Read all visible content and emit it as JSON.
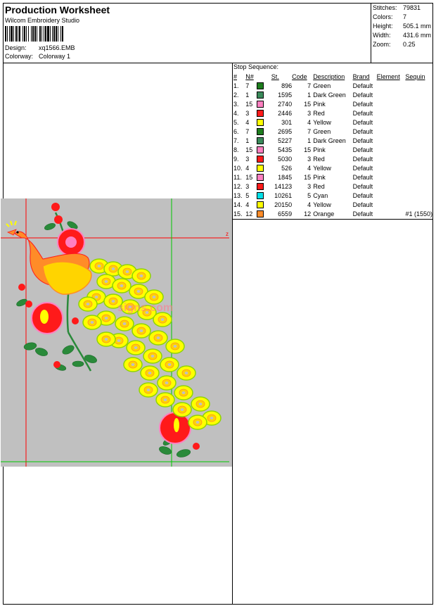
{
  "header": {
    "title": "Production Worksheet",
    "software": "Wilcom Embroidery Studio",
    "design_label": "Design:",
    "design_value": "xq1566.EMB",
    "colorway_label": "Colorway:",
    "colorway_value": "Colorway 1"
  },
  "stats": [
    {
      "label": "Stitches:",
      "value": "79831"
    },
    {
      "label": "Colors:",
      "value": "7"
    },
    {
      "label": "Height:",
      "value": "505.1 mm"
    },
    {
      "label": "Width:",
      "value": "431.6 mm"
    },
    {
      "label": "Zoom:",
      "value": "0.25"
    }
  ],
  "stop_sequence": {
    "title": "Stop Sequence:",
    "columns": [
      "#",
      "N#",
      "St.",
      "Code",
      "Description",
      "Brand",
      "Element",
      "Sequin"
    ],
    "rows": [
      {
        "num": "1.",
        "n": "7",
        "color": "#1e7d1e",
        "st": "896",
        "code": "7",
        "desc": "Green",
        "brand": "Default",
        "element": "",
        "sequin": ""
      },
      {
        "num": "2.",
        "n": "1",
        "color": "#3a8a5a",
        "st": "1595",
        "code": "1",
        "desc": "Dark Green",
        "brand": "Default",
        "element": "",
        "sequin": ""
      },
      {
        "num": "3.",
        "n": "15",
        "color": "#ff7fc0",
        "st": "2740",
        "code": "15",
        "desc": "Pink",
        "brand": "Default",
        "element": "",
        "sequin": ""
      },
      {
        "num": "4.",
        "n": "3",
        "color": "#ff1a1a",
        "st": "2446",
        "code": "3",
        "desc": "Red",
        "brand": "Default",
        "element": "",
        "sequin": ""
      },
      {
        "num": "5.",
        "n": "4",
        "color": "#ffff00",
        "st": "301",
        "code": "4",
        "desc": "Yellow",
        "brand": "Default",
        "element": "",
        "sequin": ""
      },
      {
        "num": "6.",
        "n": "7",
        "color": "#1e7d1e",
        "st": "2695",
        "code": "7",
        "desc": "Green",
        "brand": "Default",
        "element": "",
        "sequin": ""
      },
      {
        "num": "7.",
        "n": "1",
        "color": "#3a8a5a",
        "st": "5227",
        "code": "1",
        "desc": "Dark Green",
        "brand": "Default",
        "element": "",
        "sequin": ""
      },
      {
        "num": "8.",
        "n": "15",
        "color": "#ff7fc0",
        "st": "5435",
        "code": "15",
        "desc": "Pink",
        "brand": "Default",
        "element": "",
        "sequin": ""
      },
      {
        "num": "9.",
        "n": "3",
        "color": "#ff1a1a",
        "st": "5030",
        "code": "3",
        "desc": "Red",
        "brand": "Default",
        "element": "",
        "sequin": ""
      },
      {
        "num": "10.",
        "n": "4",
        "color": "#ffff00",
        "st": "526",
        "code": "4",
        "desc": "Yellow",
        "brand": "Default",
        "element": "",
        "sequin": ""
      },
      {
        "num": "11.",
        "n": "15",
        "color": "#ff7fc0",
        "st": "1845",
        "code": "15",
        "desc": "Pink",
        "brand": "Default",
        "element": "",
        "sequin": ""
      },
      {
        "num": "12.",
        "n": "3",
        "color": "#ff1a1a",
        "st": "14123",
        "code": "3",
        "desc": "Red",
        "brand": "Default",
        "element": "",
        "sequin": ""
      },
      {
        "num": "13.",
        "n": "5",
        "color": "#00e0e8",
        "st": "10261",
        "code": "5",
        "desc": "Cyan",
        "brand": "Default",
        "element": "",
        "sequin": ""
      },
      {
        "num": "14.",
        "n": "4",
        "color": "#ffff00",
        "st": "20150",
        "code": "4",
        "desc": "Yellow",
        "brand": "Default",
        "element": "",
        "sequin": ""
      },
      {
        "num": "15.",
        "n": "12",
        "color": "#ff8c28",
        "st": "6559",
        "code": "12",
        "desc": "Orange",
        "brand": "Default",
        "element": "",
        "sequin": "#1 (1550)"
      }
    ]
  },
  "preview": {
    "watermark": "signs.com",
    "axis_mark": "z",
    "background_color": "#c0c0c0",
    "guide_red": "#ff0000",
    "guide_green": "#00c800"
  }
}
